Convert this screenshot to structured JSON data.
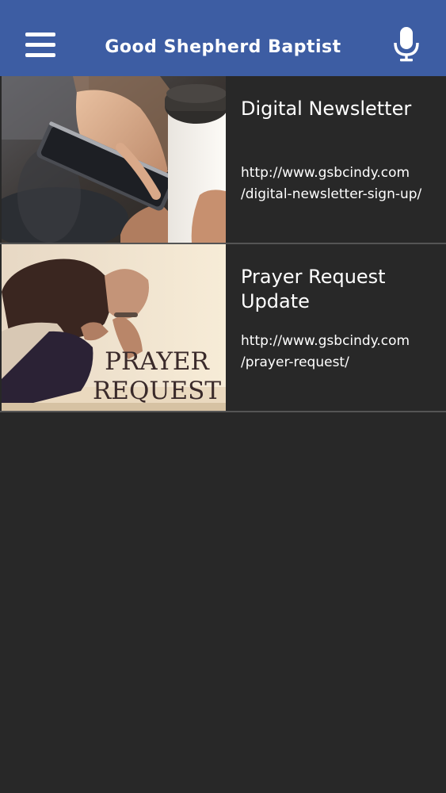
{
  "header": {
    "title": "Good Shepherd Baptist",
    "menu_icon": "hamburger-menu-icon",
    "voice_icon": "microphone-icon",
    "bar_color": "#3d5da3"
  },
  "feed": {
    "items": [
      {
        "title": "Digital Newsletter",
        "url_line1": "http://www.gsbcindy.com",
        "url_line2": "/digital-newsletter-sign-up/",
        "image": "phone-and-coffee-photo"
      },
      {
        "title": "Prayer Request Update",
        "url_line1": "http://www.gsbcindy.com",
        "url_line2": "/prayer-request/",
        "image": "praying-woman-photo",
        "image_text": [
          "PRAYER",
          "REQUEST"
        ]
      }
    ]
  },
  "colors": {
    "background": "#282828",
    "divider": "#555555",
    "text": "#ffffff"
  }
}
